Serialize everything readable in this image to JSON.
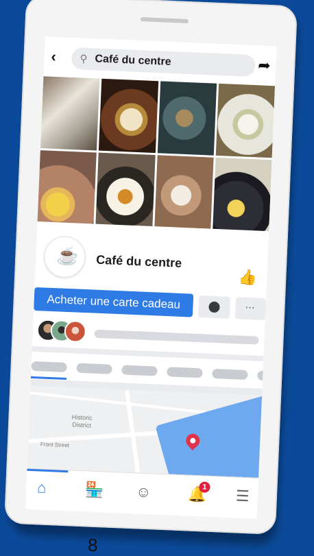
{
  "search": {
    "query": "Café du centre"
  },
  "page": {
    "name": "Café du centre",
    "gift_button_label": "Acheter une carte cadeau"
  },
  "map": {
    "label_district": "Historic\nDistrict",
    "label_street": "Front Street"
  },
  "notifications": {
    "count": "1"
  },
  "footer": {
    "page_number": "8"
  },
  "icons": [
    "back-icon",
    "search-icon",
    "share-icon",
    "like-icon",
    "messenger-icon",
    "more-icon",
    "home-icon",
    "shop-icon",
    "profile-icon",
    "bell-icon",
    "menu-icon",
    "map-pin-icon"
  ],
  "colors": {
    "accent": "#2f7be6",
    "background": "#0b4a9a",
    "badge": "#e41e3f",
    "pin": "#e0334a"
  }
}
